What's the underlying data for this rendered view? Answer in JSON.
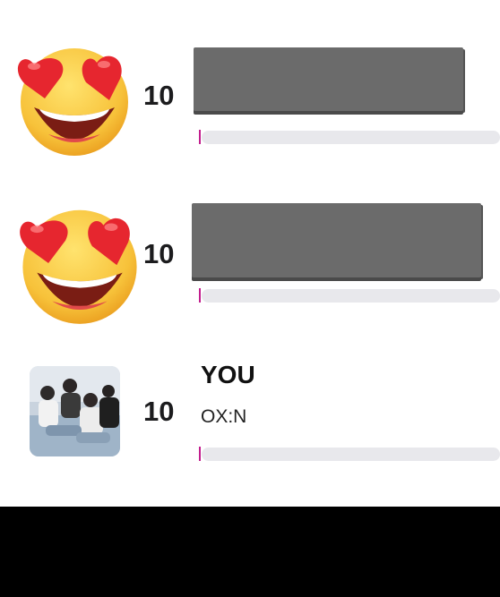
{
  "entries": [
    {
      "rank": "10",
      "title": "",
      "artist": "",
      "icon": "heart-eyes-emoji-icon",
      "progress": 0.0
    },
    {
      "rank": "10",
      "title": "",
      "artist": "",
      "icon": "heart-eyes-emoji-icon",
      "progress": 0.0
    },
    {
      "rank": "10",
      "title": "YOU",
      "artist": "OX:N",
      "icon": "album-cover",
      "progress": 0.0
    }
  ],
  "colors": {
    "tick": "#c21e8d",
    "track": "#e8e8ec",
    "redaction": "#6b6b6b"
  }
}
